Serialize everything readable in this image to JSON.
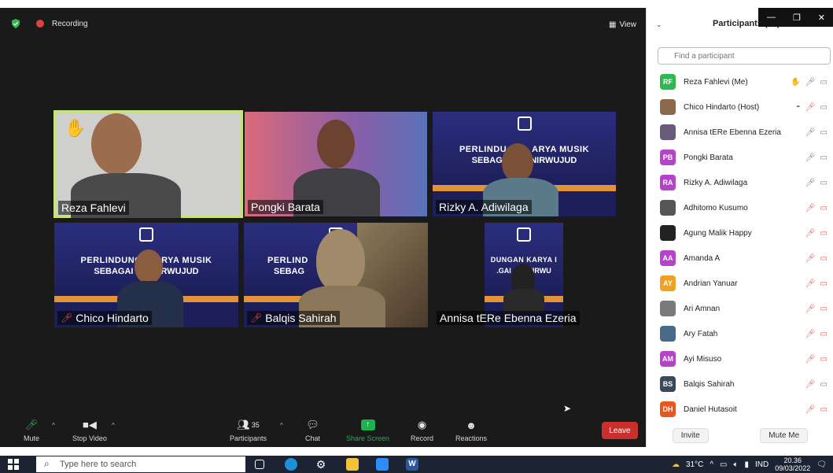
{
  "meeting": {
    "recording_label": "Recording",
    "view_label": "View",
    "tiles": [
      {
        "name": "Reza Fahlevi",
        "muted": false,
        "active": true
      },
      {
        "name": "Pongki Barata",
        "muted": false,
        "active": false
      },
      {
        "name": "Rizky A. Adiwilaga",
        "muted": false,
        "active": false
      },
      {
        "name": "Chico Hindarto",
        "muted": true,
        "active": false
      },
      {
        "name": "Balqis Sahirah",
        "muted": true,
        "active": false
      },
      {
        "name": "Annisa tERe Ebenna Ezeria",
        "muted": false,
        "active": false
      }
    ]
  },
  "toolbar": {
    "mute_label": "Mute",
    "stop_video_label": "Stop Video",
    "participants_label": "Participants",
    "participants_count": "35",
    "chat_label": "Chat",
    "share_screen_label": "Share Screen",
    "record_label": "Record",
    "reactions_label": "Reactions",
    "leave_label": "Leave"
  },
  "panel": {
    "title": "Participants (35)",
    "search_placeholder": "Find a participant",
    "participants": [
      {
        "initials": "RF",
        "name": "Reza Fahlevi (Me)",
        "color": "#2fb84f",
        "icons": "hand mic video"
      },
      {
        "initials": "",
        "name": "Chico Hindarto (Host)",
        "color": "#8a6a4a",
        "icons": "host micoff video"
      },
      {
        "initials": "",
        "name": "Annisa tERe Ebenna Ezeria",
        "color": "#6a5a7a",
        "icons": "mic video"
      },
      {
        "initials": "PB",
        "name": "Pongki Barata",
        "color": "#b443c8",
        "icons": "mic video"
      },
      {
        "initials": "RA",
        "name": "Rizky A. Adiwilaga",
        "color": "#b443c8",
        "icons": "mic video"
      },
      {
        "initials": "",
        "name": "Adhitomo Kusumo",
        "color": "#555555",
        "icons": "micoff videooff"
      },
      {
        "initials": "",
        "name": "Agung Malik Happy",
        "color": "#222222",
        "icons": "micoff videooff"
      },
      {
        "initials": "AA",
        "name": "Amanda A",
        "color": "#b443c8",
        "icons": "micoff videooff"
      },
      {
        "initials": "AY",
        "name": "Andrian Yanuar",
        "color": "#f0a022",
        "icons": "micoff videooff"
      },
      {
        "initials": "",
        "name": "Ari Amnan",
        "color": "#7a7a7a",
        "icons": "micoff videooff"
      },
      {
        "initials": "",
        "name": "Ary Fatah",
        "color": "#4a6a8a",
        "icons": "micoff videooff"
      },
      {
        "initials": "AM",
        "name": "Ayi Misuso",
        "color": "#b443c8",
        "icons": "micoff videooff"
      },
      {
        "initials": "BS",
        "name": "Balqis Sahirah",
        "color": "#3b4a5a",
        "icons": "micoff video"
      },
      {
        "initials": "DH",
        "name": "Daniel Hutasoit",
        "color": "#e8581c",
        "icons": "micoff videooff"
      }
    ],
    "invite_label": "Invite",
    "mute_me_label": "Mute Me"
  },
  "taskbar": {
    "search_placeholder": "Type here to search",
    "temperature": "31°C",
    "language": "IND",
    "time": "20.36",
    "date": "09/03/2022"
  }
}
